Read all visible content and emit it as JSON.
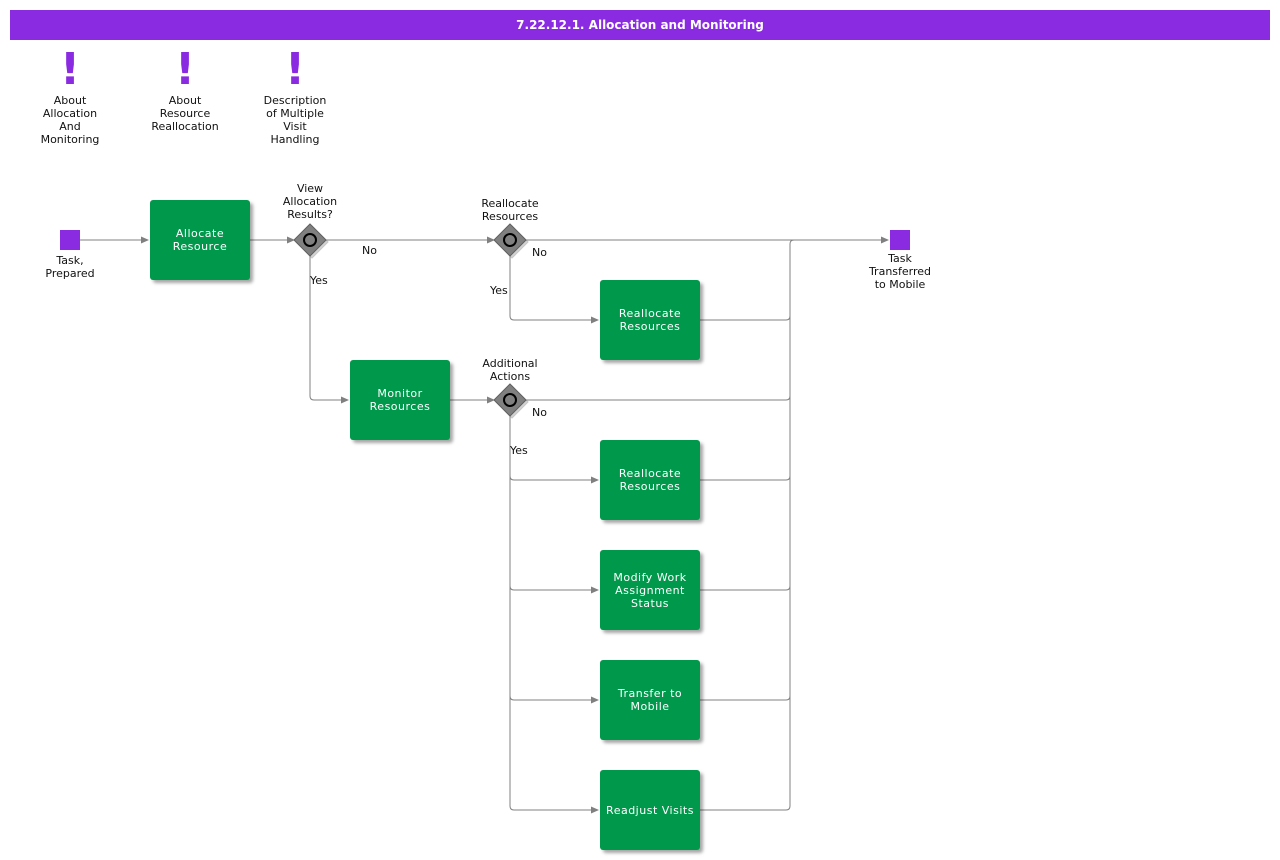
{
  "title": "7.22.12.1. Allocation and Monitoring",
  "colors": {
    "title_bar": "#8a2be2",
    "note": "#8a2be2",
    "task": "#00994c",
    "event": "#8a2be2",
    "gateway": "#808080",
    "connector": "#808080"
  },
  "notes": [
    {
      "mark": "!",
      "label": "About\nAllocation\nAnd\nMonitoring"
    },
    {
      "mark": "!",
      "label": "About\nResource\nReallocation"
    },
    {
      "mark": "!",
      "label": "Description\nof Multiple\nVisit\nHandling"
    }
  ],
  "events": {
    "start": "Task,\nPrepared",
    "end": "Task\nTransferred\nto Mobile"
  },
  "gateways": {
    "view_results": "View\nAllocation\nResults?",
    "reallocate": "Reallocate\nResources",
    "additional": "Additional\nActions"
  },
  "tasks": {
    "allocate": "Allocate Resource",
    "reallocate_top": "Reallocate Resources",
    "monitor": "Monitor Resources",
    "reallocate_mid": "Reallocate Resources",
    "modify": "Modify Work Assignment Status",
    "transfer": "Transfer to Mobile",
    "readjust": "Readjust Visits"
  },
  "flow_labels": {
    "view_no": "No",
    "view_yes": "Yes",
    "realloc_no": "No",
    "realloc_yes": "Yes",
    "additional_no": "No",
    "additional_yes": "Yes"
  }
}
